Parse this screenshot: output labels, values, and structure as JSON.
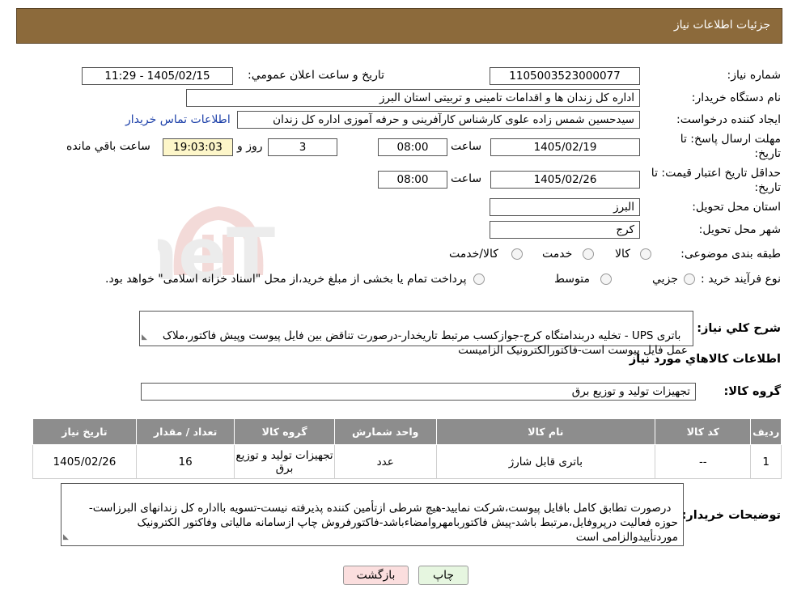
{
  "header": {
    "title": "جزئیات اطلاعات نیاز"
  },
  "need_number": {
    "label": "شماره نیاز:",
    "value": "1105003523000077"
  },
  "announce_datetime": {
    "label": "تاریخ و ساعت اعلان عمومي:",
    "value": "1405/02/15 - 11:29"
  },
  "buyer_org": {
    "label": "نام دستگاه خریدار:",
    "value": "اداره کل زندان ها و اقدامات تامینی و تربیتی استان البرز"
  },
  "requester": {
    "label": "ایجاد کننده درخواست:",
    "value": "سیدحسین شمس زاده علوی کارشناس کارآفرینی و حرفه آموزی اداره کل زندان",
    "contact_link": "اطلاعات تماس خریدار"
  },
  "reply_deadline": {
    "label_line1": "مهلت ارسال پاسخ: تا",
    "label_line2": "تاریخ:",
    "date": "1405/02/19",
    "time_label": "ساعت",
    "time": "08:00",
    "days": "3",
    "days_label": "روز و",
    "remaining_time": "19:03:03",
    "remaining_label": "ساعت باقي مانده"
  },
  "price_validity": {
    "label_line1": "حداقل تاریخ اعتبار قیمت: تا",
    "label_line2": "تاریخ:",
    "date": "1405/02/26",
    "time_label": "ساعت",
    "time": "08:00"
  },
  "delivery_province": {
    "label": "استان محل تحویل:",
    "value": "البرز"
  },
  "delivery_city": {
    "label": "شهر محل تحویل:",
    "value": "کرج"
  },
  "category": {
    "label": "طبقه بندی موضوعی:",
    "options": [
      "کالا",
      "خدمت",
      "کالا/خدمت"
    ]
  },
  "purchase_process": {
    "label": "نوع فرآیند خرید :",
    "options": [
      "جزیي",
      "متوسط"
    ],
    "note": "پرداخت تمام یا بخشی از مبلغ خرید،از محل \"اسناد خزانه اسلامی\" خواهد بود."
  },
  "description": {
    "label": "شرح کلي نياز:",
    "value": "باتری UPS - تخلیه دربندامتگاه کرج-جوازکسب مرتبط تاریخدار-درصورت تناقض بین فایل پیوست وپیش فاکتور،ملاک عمل فایل پیوست است-فاکتورالکترونیک الزامیست"
  },
  "goods_section": {
    "title": "اطلاعات کالاهاي مورد نياز"
  },
  "goods_group": {
    "label": "گروه کالا:",
    "value": "تجهیزات تولید و توزیع برق"
  },
  "table": {
    "headers": [
      "ردیف",
      "کد کالا",
      "نام کالا",
      "واحد شمارش",
      "گروه کالا",
      "تعداد / مقدار",
      "تاریخ نیاز"
    ],
    "rows": [
      [
        "1",
        "--",
        "باتری قابل شارژ",
        "عدد",
        "تجهیزات تولید و توزیع برق",
        "16",
        "1405/02/26"
      ]
    ]
  },
  "buyer_notes": {
    "label": "توضیحات خریدار:",
    "value": "درصورت تطابق کامل بافایل پیوست،شرکت نمایید-هیچ شرطی ازتأمین کننده پذیرفته نیست-تسویه بااداره کل زندانهای البرزاست-حوزه فعالیت درپروفایل،مرتبط باشد-پیش فاکتوربامهروامضاءباشد-فاکتورفروش چاپ ازسامانه مالیاتی وفاکتور الکترونیک موردتأییدوالزامی است"
  },
  "buttons": {
    "print": "چاپ",
    "back": "بازگشت"
  },
  "watermark": {
    "text": "AriaTender.neT"
  },
  "colors": {
    "header_bg": "#8c6a3b",
    "table_header_bg": "#8d8d8d",
    "link": "#1a3ea8",
    "remaining_bg": "#fdf6c9",
    "back_button_bg": "#fbdede",
    "print_button_bg": "#e6f6e0"
  }
}
